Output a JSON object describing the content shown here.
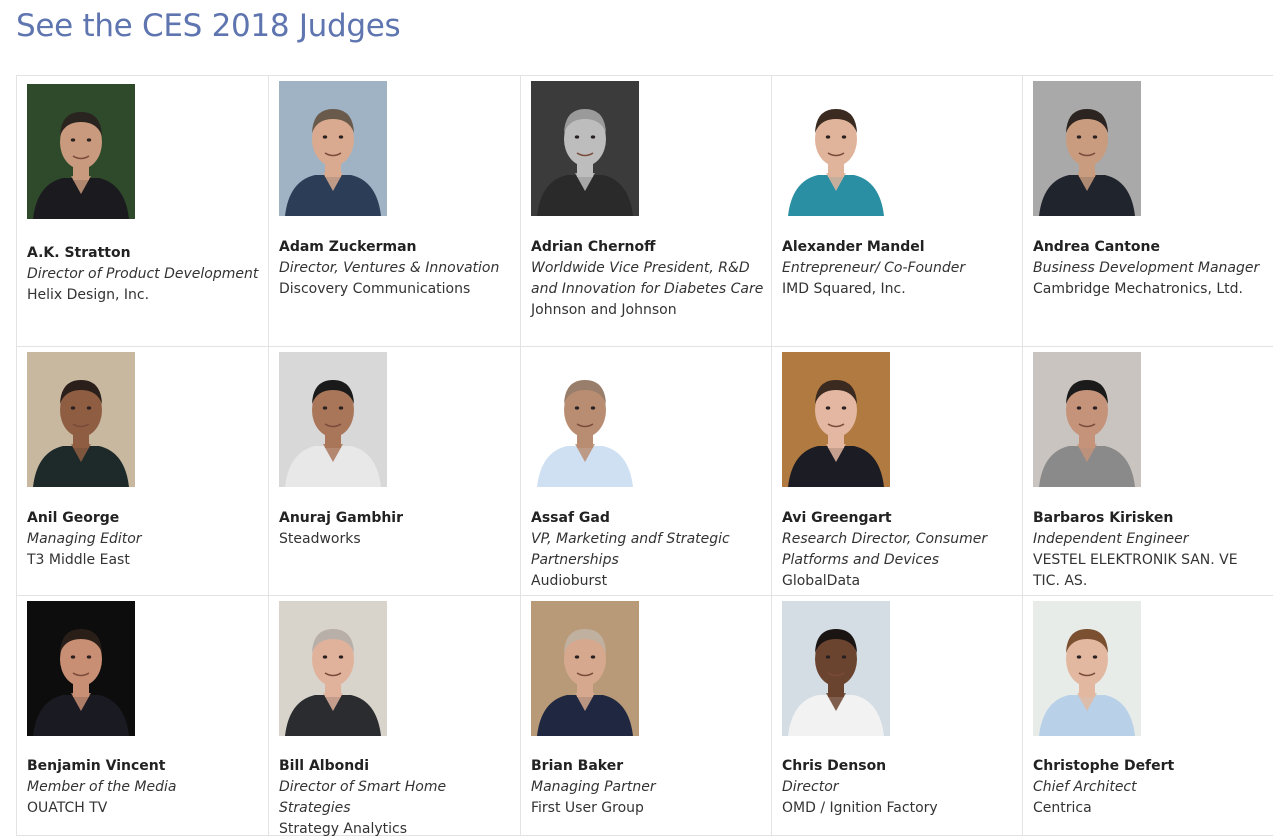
{
  "page": {
    "heading": "See the CES 2018 Judges"
  },
  "colors": {
    "heading": "#5f75b0",
    "border": "#e3e3e3",
    "text": "#333333"
  },
  "judges": [
    {
      "name": "A.K. Stratton",
      "title": "Director of Product Development",
      "company": "Helix Design, Inc.",
      "photo": "portrait-photo"
    },
    {
      "name": "Adam Zuckerman",
      "title": "Director, Ventures & Innovation",
      "company": "Discovery Communications",
      "photo": "portrait-photo"
    },
    {
      "name": "Adrian Chernoff",
      "title": "Worldwide Vice President, R&D and Innovation for Diabetes Care",
      "company": "Johnson and Johnson",
      "photo": "portrait-photo"
    },
    {
      "name": "Alexander Mandel",
      "title": "Entrepreneur/ Co-Founder",
      "company": "IMD Squared, Inc.",
      "photo": "portrait-photo"
    },
    {
      "name": "Andrea Cantone",
      "title": "Business Development Manager",
      "company": "Cambridge Mechatronics, Ltd.",
      "photo": "portrait-photo"
    },
    {
      "name": "Anil George",
      "title": "Managing Editor",
      "company": "T3 Middle East",
      "photo": "portrait-photo"
    },
    {
      "name": "Anuraj Gambhir",
      "title": "",
      "company": "Steadworks",
      "photo": "portrait-photo"
    },
    {
      "name": "Assaf Gad",
      "title": "VP, Marketing andf Strategic Partnerships",
      "company": "Audioburst",
      "photo": "portrait-photo"
    },
    {
      "name": "Avi Greengart",
      "title": "Research Director, Consumer Platforms and Devices",
      "company": "GlobalData",
      "photo": "portrait-photo"
    },
    {
      "name": "Barbaros Kirisken",
      "title": "Independent Engineer",
      "company": "VESTEL ELEKTRONIK SAN. VE TIC. AS.",
      "photo": "portrait-photo"
    },
    {
      "name": "Benjamin Vincent",
      "title": "Member of the Media",
      "company": "OUATCH TV",
      "photo": "portrait-photo"
    },
    {
      "name": "Bill Albondi",
      "title": "Director of Smart Home Strategies",
      "company": "Strategy Analytics",
      "photo": "portrait-photo"
    },
    {
      "name": "Brian Baker",
      "title": "Managing Partner",
      "company": "First User Group",
      "photo": "portrait-photo"
    },
    {
      "name": "Chris Denson",
      "title": "Director",
      "company": "OMD / Ignition Factory",
      "photo": "portrait-photo"
    },
    {
      "name": "Christophe Defert",
      "title": "Chief Architect",
      "company": "Centrica",
      "photo": "portrait-photo"
    }
  ]
}
